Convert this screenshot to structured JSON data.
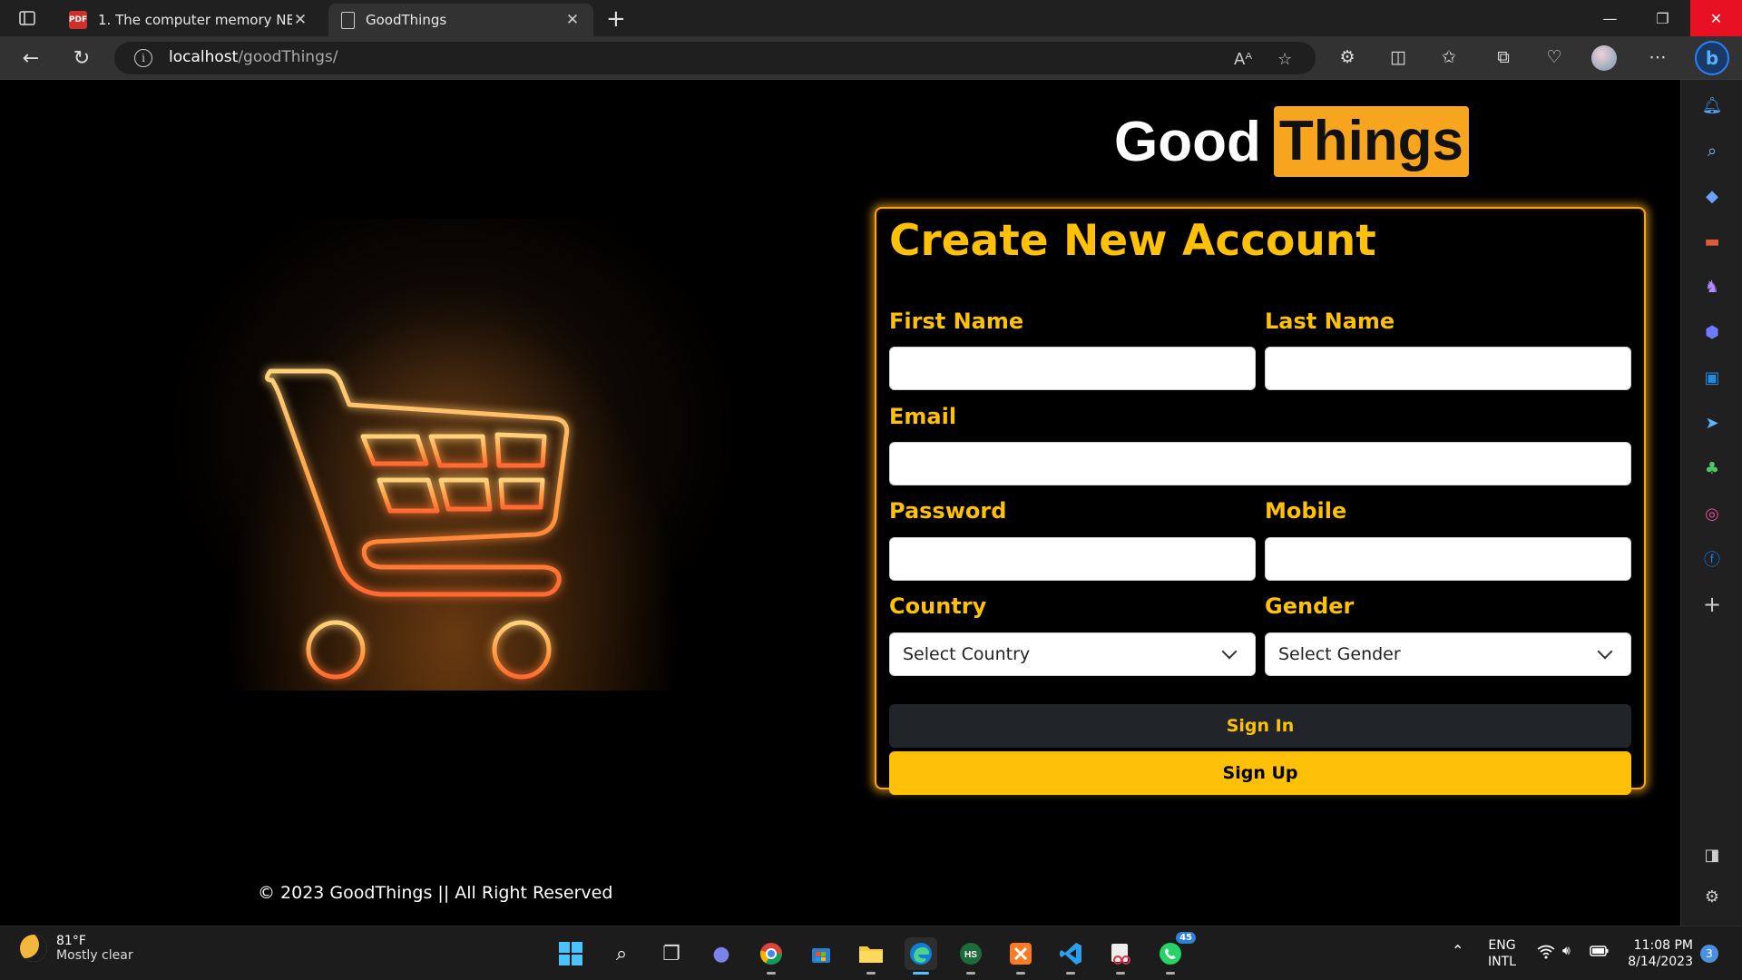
{
  "browser": {
    "tabs": [
      {
        "label": "1. The computer memory NEW.p",
        "icon": "pdf-icon"
      },
      {
        "label": "GoodThings",
        "icon": "page-icon"
      }
    ],
    "url_host": "localhost",
    "url_path": "/goodThings/",
    "read_aloud_label": "Aᴬ"
  },
  "logo": {
    "word1": "Good",
    "word2": "Things"
  },
  "form": {
    "title": "Create New Account",
    "first_name_label": "First Name",
    "last_name_label": "Last Name",
    "email_label": "Email",
    "password_label": "Password",
    "mobile_label": "Mobile",
    "country_label": "Country",
    "gender_label": "Gender",
    "country_value": "Select Country",
    "gender_value": "Select Gender",
    "signin_label": "Sign In",
    "signup_label": "Sign Up"
  },
  "footer": {
    "text": "© 2023 GoodThings || All Right Reserved"
  },
  "taskbar": {
    "weather_temp": "81°F",
    "weather_cond": "Mostly clear",
    "whatsapp_badge": "45",
    "lang_line1": "ENG",
    "lang_line2": "INTL",
    "time": "11:08 PM",
    "date": "8/14/2023",
    "notifications": "3"
  },
  "colors": {
    "accent": "#ffc107",
    "logo_orange": "#f7a51e",
    "background": "#000000"
  }
}
